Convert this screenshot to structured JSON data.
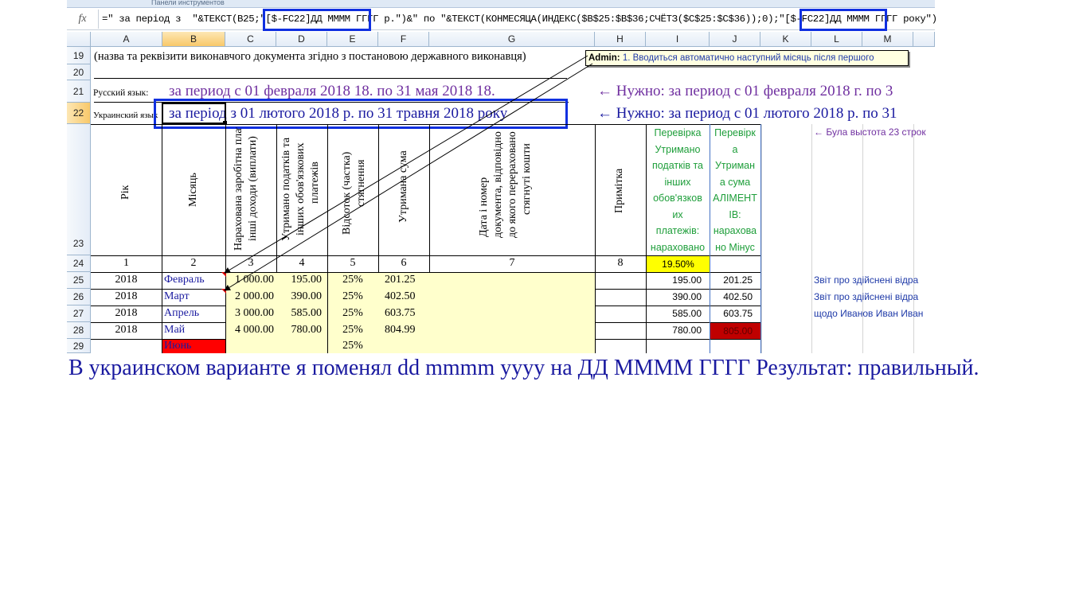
{
  "ribbon": {
    "panel_label": "Панели инструментов"
  },
  "formula_bar": {
    "fx_label": "fx",
    "formula": "=\" за період з  \"&ТЕКСТ(B25;\"[$-FC22]ДД ММММ ГГГГ р.\")&\" по \"&ТЕКСТ(КОНМЕСЯЦА(ИНДЕКС($B$25:$B$36;СЧЁТЗ($C$25:$C$36));0);\"[$-FC22]ДД ММММ ГГГГ року\")"
  },
  "columns": [
    "A",
    "B",
    "C",
    "D",
    "E",
    "F",
    "G",
    "H",
    "I",
    "J",
    "K",
    "L",
    "M"
  ],
  "rows": [
    "19",
    "20",
    "21",
    "22",
    "23",
    "24",
    "25",
    "26",
    "27",
    "28",
    "29"
  ],
  "row19": {
    "text": "(назва та реквізити виконавчого документа згідно з постановою державного виконавця)"
  },
  "comment": {
    "author": "Admin:",
    "text": "1. Вводиться автоматично наступний місяць після першого"
  },
  "row21": {
    "label": "Русский язык:",
    "text": "за период с  01 февраля 2018 18.  по 31 мая 2018 18.",
    "note": "← Нужно: за период с  01 февраля 2018 г.  по 3"
  },
  "row22": {
    "label": "Украинский язык",
    "text": "за період з  01 лютого 2018 р. по 31 травня 2018 року",
    "note": "← Нужно: за период с  01 лютого 2018 р.  по 31"
  },
  "headers": {
    "year": "Рік",
    "month": "Місяць",
    "accrued": [
      "Нарахована заробітна плата",
      "інші доходи (виплати)"
    ],
    "withheld_taxes": [
      "Утримано податків та",
      "інших обов'язкових",
      "платежів"
    ],
    "percent": [
      "Відсоток (частка)",
      "стягнення"
    ],
    "withheld_sum": [
      "Утримана сума"
    ],
    "doc_date": [
      "Дата і номер",
      "документа, відповідно",
      "до якого перераховано",
      "стягнуті кошти"
    ],
    "note": [
      "Примітка"
    ],
    "check1": [
      "Перевірка",
      "Утримано",
      "податків та",
      "інших",
      "обов'язков",
      "их",
      "платежів:",
      "нараховано"
    ],
    "check2": [
      "Перевірк",
      "а",
      "Утриман",
      "а сума",
      "АЛІМЕНТ",
      "ІВ:",
      "нарахова",
      "но Мінус"
    ],
    "side_note": "← Була выстота 23 строк"
  },
  "numbering": [
    "1",
    "2",
    "3",
    "4",
    "5",
    "6",
    "7",
    "8"
  ],
  "tax_rate": "19.50%",
  "data_rows": [
    {
      "year": "2018",
      "month": "Февраль",
      "accrued": "1 000.00",
      "tax": "195.00",
      "pct": "25%",
      "withheld": "201.25",
      "check1": "195.00",
      "check2": "201.25",
      "side": "Звіт про здійснені відра"
    },
    {
      "year": "2018",
      "month": "Март",
      "accrued": "2 000.00",
      "tax": "390.00",
      "pct": "25%",
      "withheld": "402.50",
      "check1": "390.00",
      "check2": "402.50",
      "side": "Звіт про здійснені відра"
    },
    {
      "year": "2018",
      "month": "Апрель",
      "accrued": "3 000.00",
      "tax": "585.00",
      "pct": "25%",
      "withheld": "603.75",
      "check1": "585.00",
      "check2": "603.75",
      "side": "щодо Иванов Иван Иван"
    },
    {
      "year": "2018",
      "month": "Май",
      "accrued": "4 000.00",
      "tax": "780.00",
      "pct": "25%",
      "withheld": "804.99",
      "check1": "780.00",
      "check2": "805.00",
      "side": ""
    },
    {
      "year": "",
      "month": "Июнь",
      "accrued": "",
      "tax": "",
      "pct": "25%",
      "withheld": "",
      "check1": "",
      "check2": "",
      "side": ""
    }
  ],
  "caption": "В украинском варианте я поменял dd mmmm yyyy на ДД ММММ ГГГГ Результат: правильный.",
  "colors": {
    "accent_blue": "#1030e0",
    "red_cell": "#ff0000",
    "dark_red_cell": "#c00000",
    "yellow_cell": "#ffffcc",
    "tax_yellow": "#ffff00",
    "green_text": "#1e9e3a",
    "purple_text": "#7030a0"
  }
}
